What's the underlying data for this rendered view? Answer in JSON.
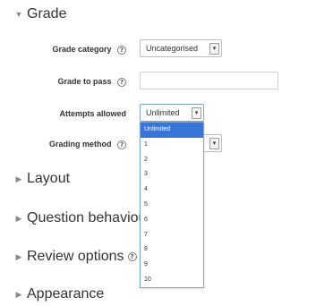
{
  "sections": {
    "grade": {
      "title": "Grade",
      "expanded": true
    },
    "layout": {
      "title": "Layout"
    },
    "question_behaviour": {
      "title": "Question behaviour"
    },
    "review_options": {
      "title": "Review options"
    },
    "appearance": {
      "title": "Appearance"
    }
  },
  "fields": {
    "grade_category": {
      "label": "Grade category",
      "value": "Uncategorised"
    },
    "grade_to_pass": {
      "label": "Grade to pass",
      "value": ""
    },
    "attempts_allowed": {
      "label": "Attempts allowed",
      "value": "Unlimited"
    },
    "grading_method": {
      "label": "Grading method",
      "value": ""
    }
  },
  "help_glyph": "?",
  "arrow_glyph": "▾",
  "dropdown": {
    "options": [
      "Unlimited",
      "1",
      "2",
      "3",
      "4",
      "5",
      "6",
      "7",
      "8",
      "9",
      "10"
    ],
    "selected": "Unlimited"
  },
  "colors": {
    "highlight": "#3875d7",
    "dropdown_border": "#7fa5d6"
  }
}
